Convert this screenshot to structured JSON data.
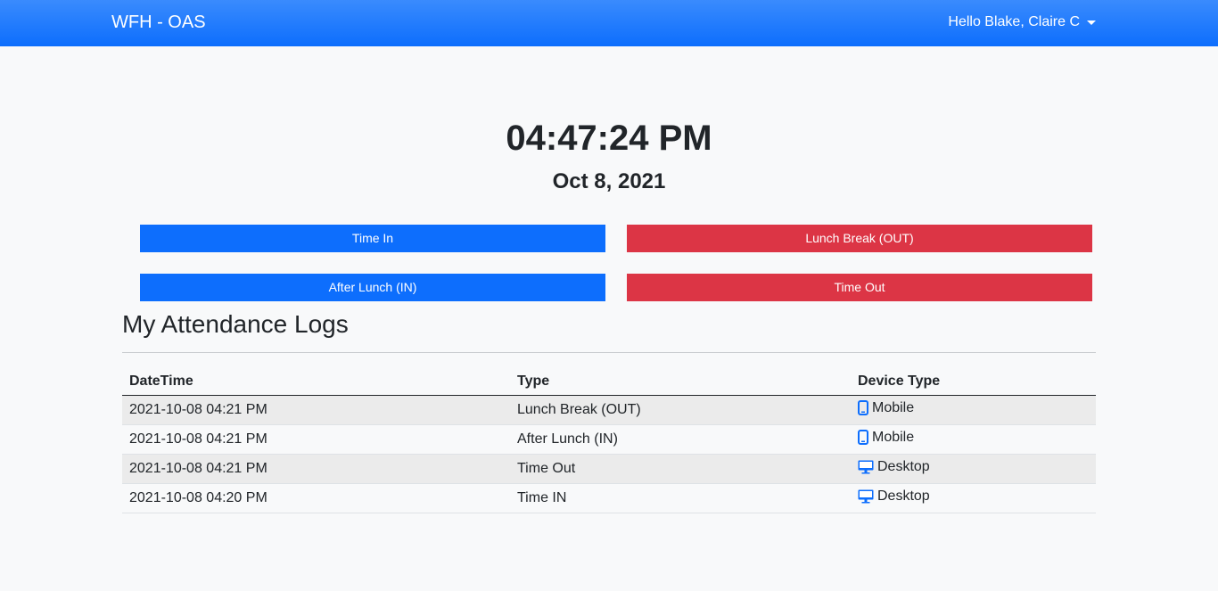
{
  "app": {
    "brand": "WFH - OAS",
    "user_greeting": "Hello Blake, Claire C"
  },
  "clock": {
    "time": "04:47:24 PM",
    "date": "Oct 8, 2021"
  },
  "buttons": {
    "time_in": "Time In",
    "lunch_out": "Lunch Break (OUT)",
    "after_lunch_in": "After Lunch (IN)",
    "time_out": "Time Out"
  },
  "logs": {
    "title": "My Attendance Logs",
    "columns": [
      "DateTime",
      "Type",
      "Device Type"
    ],
    "rows": [
      {
        "datetime": "2021-10-08 04:21 PM",
        "type": "Lunch Break (OUT)",
        "device": "Mobile",
        "icon": "mobile-icon"
      },
      {
        "datetime": "2021-10-08 04:21 PM",
        "type": "After Lunch (IN)",
        "device": "Mobile",
        "icon": "mobile-icon"
      },
      {
        "datetime": "2021-10-08 04:21 PM",
        "type": "Time Out",
        "device": "Desktop",
        "icon": "desktop-icon"
      },
      {
        "datetime": "2021-10-08 04:20 PM",
        "type": "Time IN",
        "device": "Desktop",
        "icon": "desktop-icon"
      }
    ]
  },
  "colors": {
    "primary": "#0d6efd",
    "danger": "#dc3545",
    "icon": "#0d6efd"
  }
}
